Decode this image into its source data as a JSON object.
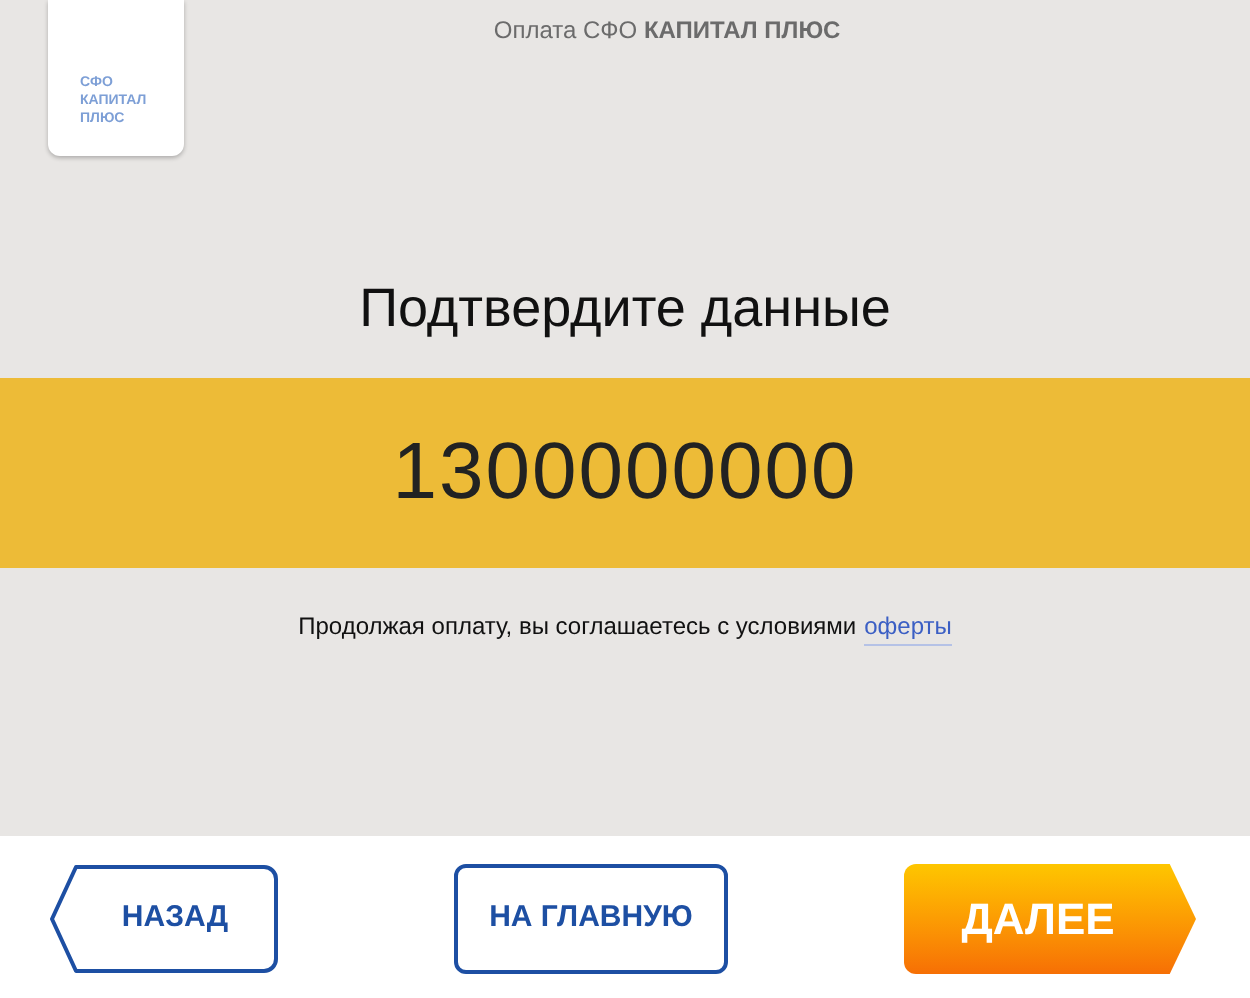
{
  "header": {
    "title": "Оплата СФО **КАПИТАЛ ПЛЮС**"
  },
  "logo": {
    "lines": [
      "СФО",
      "КАПИТАЛ",
      "ПЛЮС"
    ]
  },
  "heading": "Подтвердите данные",
  "value": "1300000000",
  "agreement": {
    "text": "Продолжая оплату, вы соглашаетесь с условиями",
    "link": "оферты"
  },
  "buttons": [
    {
      "label": "НАЗАД",
      "kind": "back"
    },
    {
      "label": "НА ГЛАВНУЮ",
      "kind": "home"
    },
    {
      "label": "ДАЛЕЕ",
      "kind": "next"
    }
  ]
}
